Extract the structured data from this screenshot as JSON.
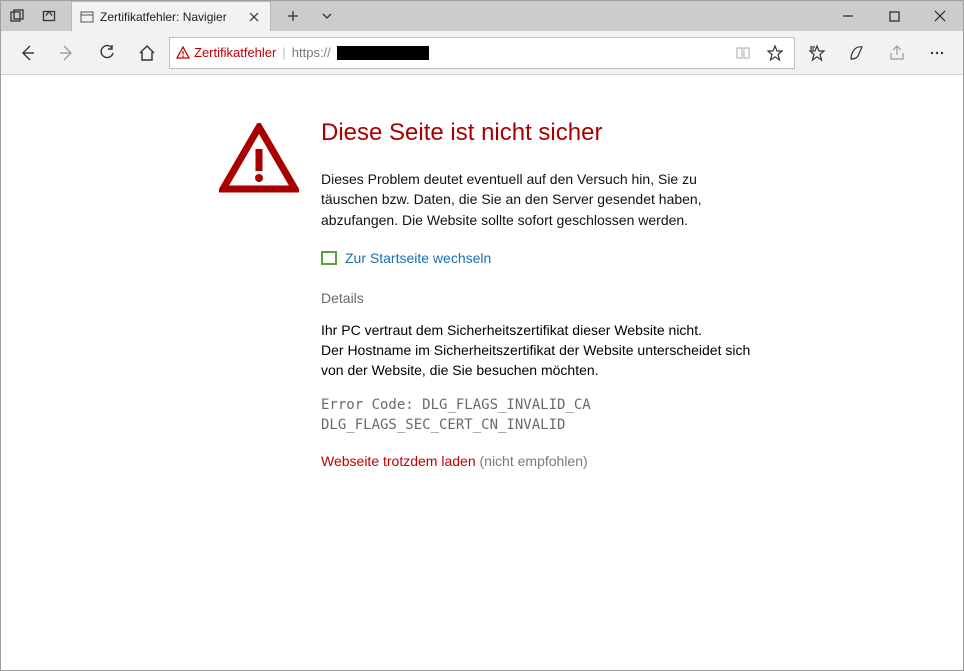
{
  "window": {
    "tab_title": "Zertifikatfehler: Navigier"
  },
  "addressbar": {
    "cert_error_label": "Zertifikatfehler",
    "url_prefix": "https://"
  },
  "page": {
    "heading": "Diese Seite ist nicht sicher",
    "warning_paragraph": "Dieses Problem deutet eventuell auf den Versuch hin, Sie zu täuschen bzw. Daten, die Sie an den Server gesendet haben, abzufangen. Die Website sollte sofort geschlossen werden.",
    "home_link": "Zur Startseite wechseln",
    "details_heading": "Details",
    "details_paragraph": "Ihr PC vertraut dem Sicherheitszertifikat dieser Website nicht.\nDer Hostname im Sicherheitszertifikat der Website unterscheidet sich von der Website, die Sie besuchen möchten.",
    "error_code": "Error Code: DLG_FLAGS_INVALID_CA\nDLG_FLAGS_SEC_CERT_CN_INVALID",
    "proceed_link": "Webseite trotzdem laden",
    "proceed_hint": "(nicht empfohlen)"
  }
}
